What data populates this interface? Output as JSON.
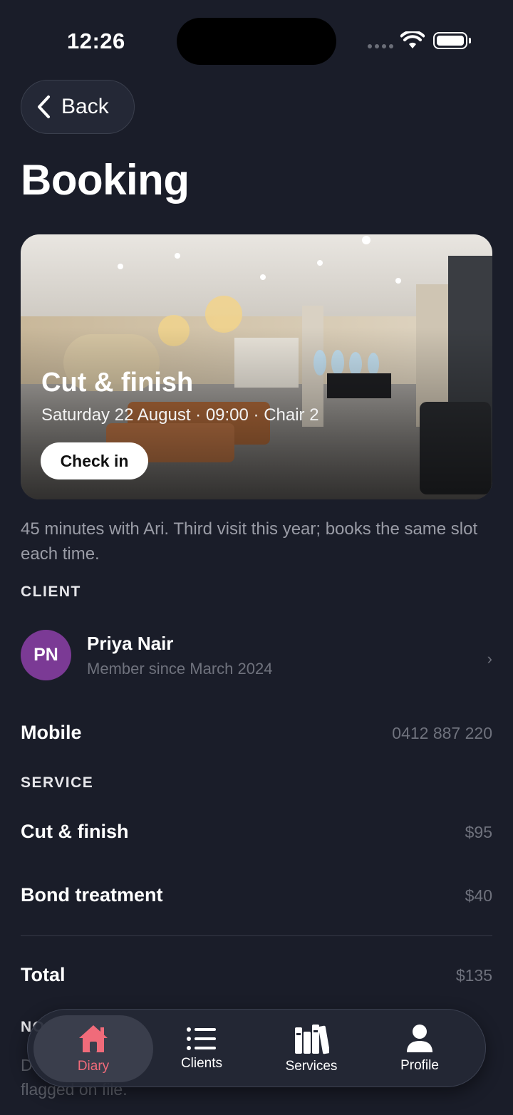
{
  "status_bar": {
    "time": "12:26"
  },
  "nav": {
    "back_label": "Back"
  },
  "page": {
    "title": "Booking"
  },
  "hero": {
    "title": "Cut & finish",
    "subtitle": "Saturday 22 August · 09:00 · Chair 2",
    "checkin_label": "Check in"
  },
  "description": "45 minutes with Ari. Third visit this year; books the same slot each time.",
  "client": {
    "section_label": "CLIENT",
    "initials": "PN",
    "name": "Priya Nair",
    "since": "Member since March 2024",
    "avatar_color": "#7b3a95",
    "mobile_label": "Mobile",
    "mobile_value": "0412 887 220"
  },
  "service": {
    "section_label": "SERVICE",
    "items": [
      {
        "name": "Cut & finish",
        "price": "$95"
      },
      {
        "name": "Bond treatment",
        "price": "$40"
      }
    ],
    "total_label": "Total",
    "total_value": "$135"
  },
  "notes": {
    "section_label": "NO",
    "text_start": "D",
    "text_end": "flagged on file."
  },
  "tabbar": {
    "tabs": [
      {
        "label": "Diary",
        "icon": "house-icon",
        "active": true
      },
      {
        "label": "Clients",
        "icon": "list-icon",
        "active": false
      },
      {
        "label": "Services",
        "icon": "books-icon",
        "active": false
      },
      {
        "label": "Profile",
        "icon": "person-icon",
        "active": false
      }
    ],
    "accent_color": "#f06b7a"
  }
}
